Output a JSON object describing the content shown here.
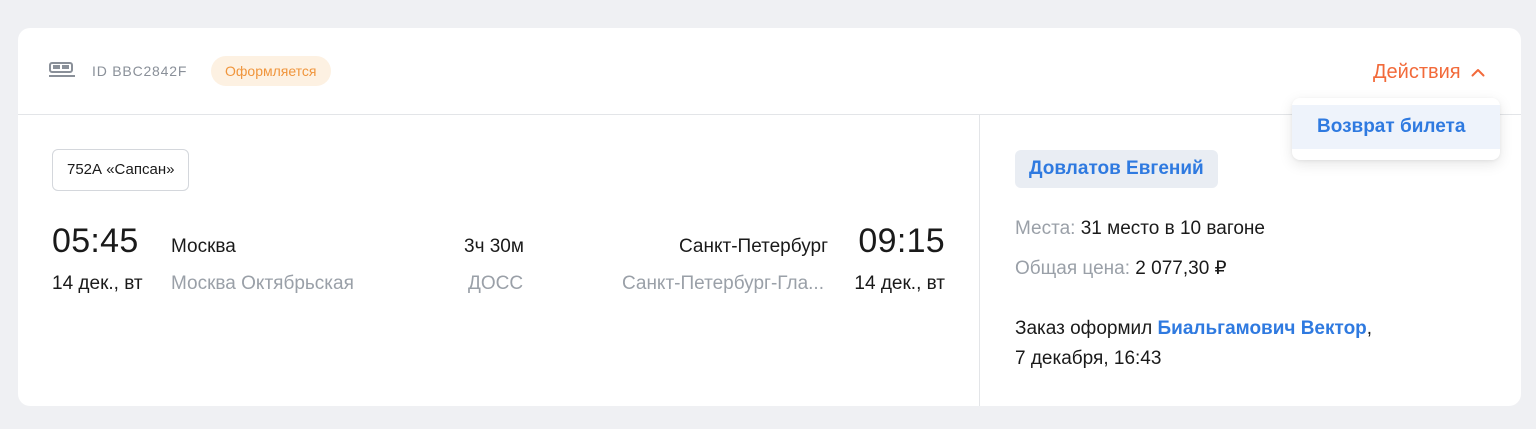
{
  "order": {
    "id_label": "ID BBC2842F",
    "status": "Оформляется",
    "actions_label": "Действия"
  },
  "train": {
    "name": "752А «Сапсан»"
  },
  "route": {
    "departure_time": "05:45",
    "departure_date": "14 дек., вт",
    "departure_city": "Москва",
    "departure_station": "Москва Октябрьская",
    "duration": "3ч 30м",
    "service": "ДОСС",
    "arrival_city": "Санкт-Петербург",
    "arrival_station": "Санкт-Петербург-Гла...",
    "arrival_time": "09:15",
    "arrival_date": "14 дек., вт"
  },
  "details": {
    "passenger": "Довлатов Евгений",
    "seats_label": "Места:",
    "seats_value": "31 место в 10 вагоне",
    "price_label": "Общая цена:",
    "price_value": "2 077,30 ₽",
    "ordered_by_prefix": "Заказ оформил",
    "ordered_by_name": "Биальгамович Вектор",
    "ordered_by_suffix": ",",
    "ordered_at": "7 декабря, 16:43"
  },
  "dropdown": {
    "items": [
      {
        "label": "Возврат билета"
      }
    ]
  },
  "colors": {
    "accent_orange": "#f26a3a",
    "status_orange": "#f0953c",
    "link_blue": "#2f7ae0",
    "page_bg": "#eff0f3"
  }
}
